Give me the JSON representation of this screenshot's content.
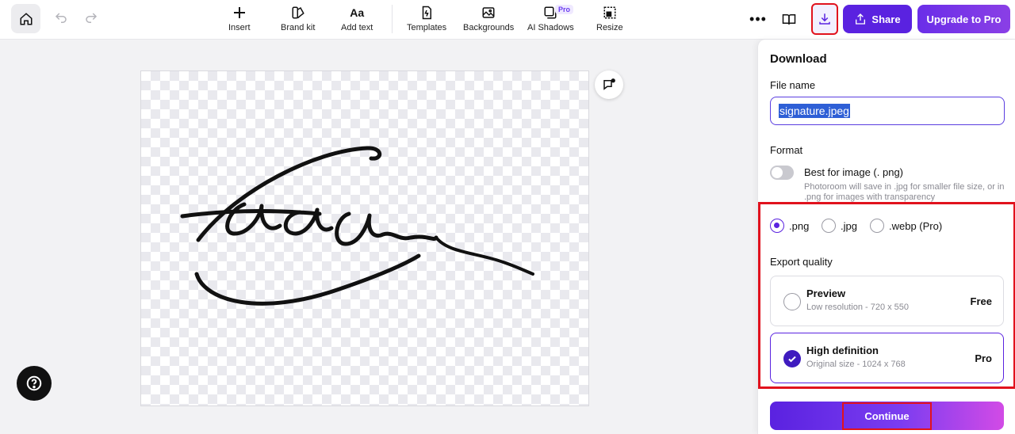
{
  "toolbar": {
    "items": [
      {
        "label": "Insert",
        "icon": "plus-icon"
      },
      {
        "label": "Brand kit",
        "icon": "brand-kit-icon"
      },
      {
        "label": "Add text",
        "icon": "text-icon"
      },
      {
        "label": "Templates",
        "icon": "templates-icon"
      },
      {
        "label": "Backgrounds",
        "icon": "backgrounds-icon"
      },
      {
        "label": "AI Shadows",
        "icon": "ai-shadows-icon"
      },
      {
        "label": "Resize",
        "icon": "resize-icon"
      }
    ],
    "ai_shadows_badge": "Pro",
    "text_icon_glyph": "Aa",
    "share_label": "Share",
    "upgrade_label": "Upgrade to Pro"
  },
  "download_panel": {
    "title": "Download",
    "file_name_label": "File name",
    "file_name_value": "signature.jpeg",
    "format_label": "Format",
    "best_for_image_label": "Best for image (. png)",
    "best_for_image_note": "Photoroom will save in .jpg for smaller file size, or in .png for images with transparency",
    "best_for_image_enabled": false,
    "formats": [
      {
        "label": ".png",
        "selected": true
      },
      {
        "label": ".jpg",
        "selected": false
      },
      {
        "label": ".webp (Pro)",
        "selected": false
      }
    ],
    "export_quality_label": "Export quality",
    "qualities": [
      {
        "title": "Preview",
        "subtitle": "Low resolution - 720 x 550",
        "tag": "Free",
        "selected": false
      },
      {
        "title": "High definition",
        "subtitle": "Original size - 1024 x 768",
        "tag": "Pro",
        "selected": true
      }
    ],
    "continue_label": "Continue"
  },
  "colors": {
    "accent": "#5a22e0",
    "highlight": "#e1121d",
    "canvas_checker": "#e9e9ee"
  }
}
